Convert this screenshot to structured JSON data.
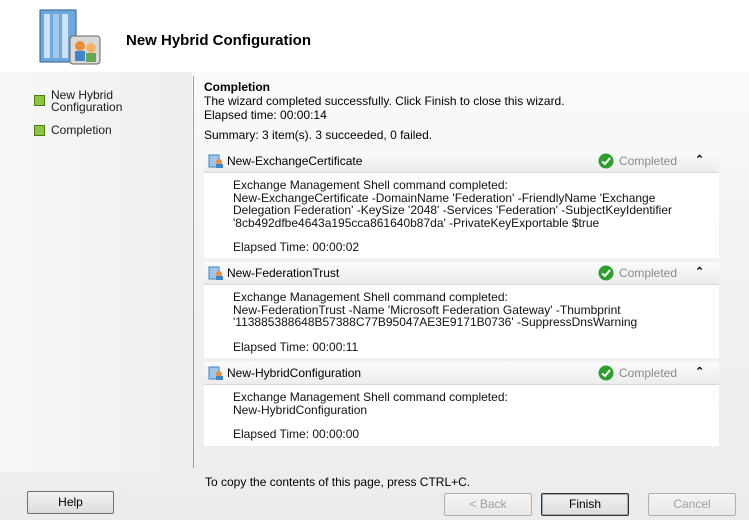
{
  "header": {
    "title": "New Hybrid Configuration",
    "icon": "server-users-icon"
  },
  "nav": {
    "items": [
      {
        "label": "New Hybrid Configuration",
        "line1": "New Hybrid",
        "line2": "Configuration"
      },
      {
        "label": "Completion"
      }
    ]
  },
  "main": {
    "title": "Completion",
    "message": "The wizard completed successfully. Click Finish to close this wizard.",
    "elapsed": "Elapsed time: 00:00:14",
    "summary": "Summary: 3 item(s). 3 succeeded, 0 failed."
  },
  "tasks": [
    {
      "name": "New-ExchangeCertificate",
      "status": "Completed",
      "lines": [
        "Exchange Management Shell command completed:",
        "New-ExchangeCertificate -DomainName 'Federation' -FriendlyName 'Exchange",
        "Delegation Federation' -KeySize '2048' -Services 'Federation' -SubjectKeyIdentifier",
        "'8cb492dfbe4643a195cca861640b87da' -PrivateKeyExportable $true"
      ],
      "elapsed": "Elapsed Time: 00:00:02"
    },
    {
      "name": "New-FederationTrust",
      "status": "Completed",
      "lines": [
        "Exchange Management Shell command completed:",
        "New-FederationTrust -Name 'Microsoft Federation Gateway' -Thumbprint",
        "'113885388648B57388C77B95047AE3E9171B0736' -SuppressDnsWarning"
      ],
      "elapsed": "Elapsed Time: 00:00:11"
    },
    {
      "name": "New-HybridConfiguration",
      "status": "Completed",
      "lines": [
        "Exchange Management Shell command completed:",
        "New-HybridConfiguration"
      ],
      "elapsed": "Elapsed Time: 00:00:00"
    }
  ],
  "footer": {
    "copy_hint": "To copy the contents of this page, press CTRL+C.",
    "help": "Help",
    "back": "< Back",
    "finish": "Finish",
    "cancel": "Cancel"
  },
  "colors": {
    "success": "#2e9e2e",
    "nav_bullet": "#8cc63f"
  }
}
